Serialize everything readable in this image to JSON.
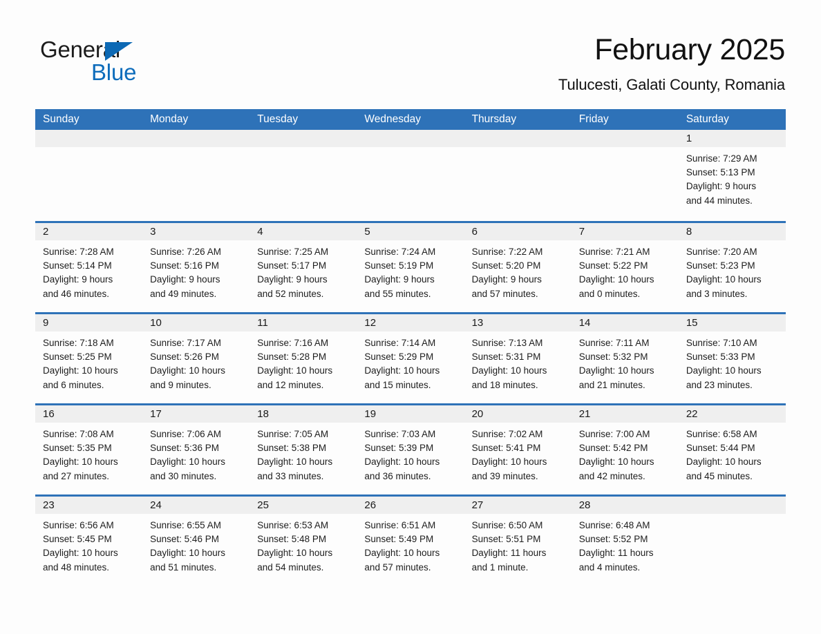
{
  "brand": {
    "name_part1": "General",
    "name_part2": "Blue",
    "triangle_icon": "triangle-icon",
    "accent_color": "#0d6cbb"
  },
  "header": {
    "month_title": "February 2025",
    "location": "Tulucesti, Galati County, Romania"
  },
  "theme": {
    "header_blue": "#2e72b8",
    "day_band_gray": "#efefef",
    "page_background": "#fdfdfd",
    "text_color": "#1a1a1a"
  },
  "weekdays": [
    "Sunday",
    "Monday",
    "Tuesday",
    "Wednesday",
    "Thursday",
    "Friday",
    "Saturday"
  ],
  "weeks": [
    [
      {
        "day": "",
        "lines": []
      },
      {
        "day": "",
        "lines": []
      },
      {
        "day": "",
        "lines": []
      },
      {
        "day": "",
        "lines": []
      },
      {
        "day": "",
        "lines": []
      },
      {
        "day": "",
        "lines": []
      },
      {
        "day": "1",
        "lines": [
          "Sunrise: 7:29 AM",
          "Sunset: 5:13 PM",
          "Daylight: 9 hours",
          "and 44 minutes."
        ]
      }
    ],
    [
      {
        "day": "2",
        "lines": [
          "Sunrise: 7:28 AM",
          "Sunset: 5:14 PM",
          "Daylight: 9 hours",
          "and 46 minutes."
        ]
      },
      {
        "day": "3",
        "lines": [
          "Sunrise: 7:26 AM",
          "Sunset: 5:16 PM",
          "Daylight: 9 hours",
          "and 49 minutes."
        ]
      },
      {
        "day": "4",
        "lines": [
          "Sunrise: 7:25 AM",
          "Sunset: 5:17 PM",
          "Daylight: 9 hours",
          "and 52 minutes."
        ]
      },
      {
        "day": "5",
        "lines": [
          "Sunrise: 7:24 AM",
          "Sunset: 5:19 PM",
          "Daylight: 9 hours",
          "and 55 minutes."
        ]
      },
      {
        "day": "6",
        "lines": [
          "Sunrise: 7:22 AM",
          "Sunset: 5:20 PM",
          "Daylight: 9 hours",
          "and 57 minutes."
        ]
      },
      {
        "day": "7",
        "lines": [
          "Sunrise: 7:21 AM",
          "Sunset: 5:22 PM",
          "Daylight: 10 hours",
          "and 0 minutes."
        ]
      },
      {
        "day": "8",
        "lines": [
          "Sunrise: 7:20 AM",
          "Sunset: 5:23 PM",
          "Daylight: 10 hours",
          "and 3 minutes."
        ]
      }
    ],
    [
      {
        "day": "9",
        "lines": [
          "Sunrise: 7:18 AM",
          "Sunset: 5:25 PM",
          "Daylight: 10 hours",
          "and 6 minutes."
        ]
      },
      {
        "day": "10",
        "lines": [
          "Sunrise: 7:17 AM",
          "Sunset: 5:26 PM",
          "Daylight: 10 hours",
          "and 9 minutes."
        ]
      },
      {
        "day": "11",
        "lines": [
          "Sunrise: 7:16 AM",
          "Sunset: 5:28 PM",
          "Daylight: 10 hours",
          "and 12 minutes."
        ]
      },
      {
        "day": "12",
        "lines": [
          "Sunrise: 7:14 AM",
          "Sunset: 5:29 PM",
          "Daylight: 10 hours",
          "and 15 minutes."
        ]
      },
      {
        "day": "13",
        "lines": [
          "Sunrise: 7:13 AM",
          "Sunset: 5:31 PM",
          "Daylight: 10 hours",
          "and 18 minutes."
        ]
      },
      {
        "day": "14",
        "lines": [
          "Sunrise: 7:11 AM",
          "Sunset: 5:32 PM",
          "Daylight: 10 hours",
          "and 21 minutes."
        ]
      },
      {
        "day": "15",
        "lines": [
          "Sunrise: 7:10 AM",
          "Sunset: 5:33 PM",
          "Daylight: 10 hours",
          "and 23 minutes."
        ]
      }
    ],
    [
      {
        "day": "16",
        "lines": [
          "Sunrise: 7:08 AM",
          "Sunset: 5:35 PM",
          "Daylight: 10 hours",
          "and 27 minutes."
        ]
      },
      {
        "day": "17",
        "lines": [
          "Sunrise: 7:06 AM",
          "Sunset: 5:36 PM",
          "Daylight: 10 hours",
          "and 30 minutes."
        ]
      },
      {
        "day": "18",
        "lines": [
          "Sunrise: 7:05 AM",
          "Sunset: 5:38 PM",
          "Daylight: 10 hours",
          "and 33 minutes."
        ]
      },
      {
        "day": "19",
        "lines": [
          "Sunrise: 7:03 AM",
          "Sunset: 5:39 PM",
          "Daylight: 10 hours",
          "and 36 minutes."
        ]
      },
      {
        "day": "20",
        "lines": [
          "Sunrise: 7:02 AM",
          "Sunset: 5:41 PM",
          "Daylight: 10 hours",
          "and 39 minutes."
        ]
      },
      {
        "day": "21",
        "lines": [
          "Sunrise: 7:00 AM",
          "Sunset: 5:42 PM",
          "Daylight: 10 hours",
          "and 42 minutes."
        ]
      },
      {
        "day": "22",
        "lines": [
          "Sunrise: 6:58 AM",
          "Sunset: 5:44 PM",
          "Daylight: 10 hours",
          "and 45 minutes."
        ]
      }
    ],
    [
      {
        "day": "23",
        "lines": [
          "Sunrise: 6:56 AM",
          "Sunset: 5:45 PM",
          "Daylight: 10 hours",
          "and 48 minutes."
        ]
      },
      {
        "day": "24",
        "lines": [
          "Sunrise: 6:55 AM",
          "Sunset: 5:46 PM",
          "Daylight: 10 hours",
          "and 51 minutes."
        ]
      },
      {
        "day": "25",
        "lines": [
          "Sunrise: 6:53 AM",
          "Sunset: 5:48 PM",
          "Daylight: 10 hours",
          "and 54 minutes."
        ]
      },
      {
        "day": "26",
        "lines": [
          "Sunrise: 6:51 AM",
          "Sunset: 5:49 PM",
          "Daylight: 10 hours",
          "and 57 minutes."
        ]
      },
      {
        "day": "27",
        "lines": [
          "Sunrise: 6:50 AM",
          "Sunset: 5:51 PM",
          "Daylight: 11 hours",
          "and 1 minute."
        ]
      },
      {
        "day": "28",
        "lines": [
          "Sunrise: 6:48 AM",
          "Sunset: 5:52 PM",
          "Daylight: 11 hours",
          "and 4 minutes."
        ]
      },
      {
        "day": "",
        "lines": []
      }
    ]
  ]
}
